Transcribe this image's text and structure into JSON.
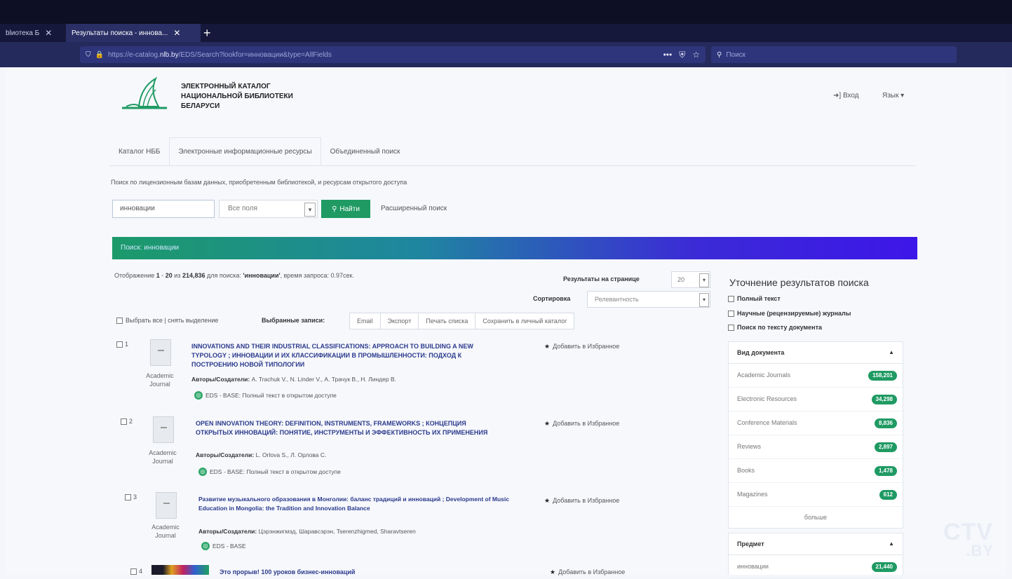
{
  "browser": {
    "tabs": [
      {
        "label": "blиотека Б",
        "active": false
      },
      {
        "label": "Результаты поиска - иннова...",
        "active": true
      }
    ],
    "new_tab": "+",
    "url_prefix": "https://e-catalog.",
    "url_host": "nlb.by",
    "url_rest": "/EDS/Search?lookfor=инновации&type=AllFields",
    "search_placeholder": "Поиск"
  },
  "header": {
    "logo_lines": [
      "ЭЛЕКТРОННЫЙ КАТАЛОГ",
      "НАЦИОНАЛЬНОЙ БИБЛИОТЕКИ",
      "БЕЛАРУСИ"
    ],
    "login": "Вход",
    "language": "Язык ▾"
  },
  "nav_tabs": [
    "Каталог НББ",
    "Электронные информационные ресурсы",
    "Объединенный поиск"
  ],
  "search": {
    "subtitle": "Поиск по лицензионным базам данных, приобретенным библиотекой, и ресурсам открытого доступа",
    "query": "инновации",
    "field": "Все поля",
    "find_button": "Найти",
    "advanced": "Расширенный поиск"
  },
  "banner": "Поиск: инновации",
  "results_info": {
    "prefix": "Отображение",
    "from": "1",
    "sep1": " - ",
    "to": "20",
    "sep2": " из ",
    "total": "214,836",
    "mid": " для поиска: ",
    "query": "'инновации'",
    "suffix": ", время запроса: 0.97сек."
  },
  "controls": {
    "per_page_label": "Результаты на странице",
    "per_page_value": "20",
    "sort_label": "Сортировка",
    "sort_value": "Релевантность",
    "select_all": "Выбрать все | снять выделение",
    "selected_records": "Выбранные записи:",
    "buttons": [
      "Email",
      "Экспорт",
      "Печать списка",
      "Сохранить в личный каталог"
    ]
  },
  "results": [
    {
      "num": "1",
      "type_line1": "Academic",
      "type_line2": "Journal",
      "title": "INNOVATIONS AND THEIR INDUSTRIAL CLASSIFICATIONS: APPROACH TO BUILDING A NEW TYPOLOGY ; ИННОВАЦИИ И ИХ КЛАССИФИКАЦИИ В ПРОМЫШЛЕННОСТИ: ПОДХОД К ПОСТРОЕНИЮ НОВОЙ ТИПОЛОГИИ",
      "authors_label": "Авторы/Создатели:",
      "authors": "A. Trachuk V., N. Linder V., А. Трачук В., Н. Линдер В.",
      "source": "EDS - BASE: Полный текст в открытом доступе",
      "fav": "Добавить в Избранное"
    },
    {
      "num": "2",
      "type_line1": "Academic",
      "type_line2": "Journal",
      "title": "OPEN INNOVATION THEORY: DEFINITION, INSTRUMENTS, FRAMEWORKS ; КОНЦЕПЦИЯ ОТКРЫТЫХ ИННОВАЦИЙ: ПОНЯТИЕ, ИНСТРУМЕНТЫ И ЭФФЕКТИВНОСТЬ ИХ ПРИМЕНЕНИЯ",
      "authors_label": "Авторы/Создатели:",
      "authors": "L. Orlova S., Л. Орлова С.",
      "source": "EDS - BASE: Полный текст в открытом доступе",
      "fav": "Добавить в Избранное"
    },
    {
      "num": "3",
      "type_line1": "Academic",
      "type_line2": "Journal",
      "title": "Развитие музыкального образования в Монголии: баланс традиций и инноваций ; Development of Music Education in Mongolia: the Tradition and Innovation Balance",
      "authors_label": "Авторы/Создатели:",
      "authors": "Цэрэнжигмэд, Шаравсэрэн, Tserenzhigmed, Sharavtseren",
      "source": "EDS - BASE",
      "fav": "Добавить в Избранное"
    },
    {
      "num": "4",
      "title": "Это прорыв! 100 уроков бизнес-инноваций",
      "fav": "Добавить в Избранное"
    }
  ],
  "refine": {
    "title": "Уточнение результатов поиска",
    "checks": [
      "Полный текст",
      "Научные (рецензируемые) журналы",
      "Поиск по тексту документа"
    ]
  },
  "facets": [
    {
      "title": "Вид документа",
      "items": [
        {
          "label": "Academic Journals",
          "count": "158,201"
        },
        {
          "label": "Electronic Resources",
          "count": "34,298"
        },
        {
          "label": "Conference Materials",
          "count": "8,836"
        },
        {
          "label": "Reviews",
          "count": "2,897"
        },
        {
          "label": "Books",
          "count": "1,478"
        },
        {
          "label": "Magazines",
          "count": "612"
        }
      ],
      "more": "больше"
    },
    {
      "title": "Предмет",
      "items": [
        {
          "label": "инновации",
          "count": "21,440"
        }
      ]
    }
  ],
  "watermark": {
    "line1": "CTV",
    "line2": ".BY"
  },
  "colors": {
    "accent_green": "#1f9a63",
    "title_blue": "#2b3a8c",
    "banner_violet": "#3d16e8"
  }
}
